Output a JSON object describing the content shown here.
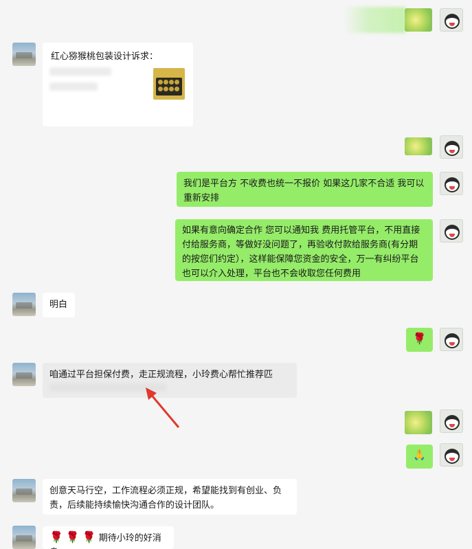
{
  "messages": [
    {
      "id": "m2",
      "text": "红心猕猴桃包装设计诉求："
    },
    {
      "id": "m4",
      "text": "我们是平台方 不收费也统一不报价  如果这几家不合适 我可以重新安排"
    },
    {
      "id": "m5",
      "text": "如果有意向确定合作 您可以通知我 费用托管平台，不用直接付给服务商，等做好没问题了，再验收付款给服务商(有分期的按您们约定），这样能保障您资金的安全，万一有纠纷平台也可以介入处理，平台也不会收取您任何费用"
    },
    {
      "id": "m6",
      "text": "明白"
    },
    {
      "id": "m8",
      "text": "咱通过平台担保付费，走正规流程，小玲费心帮忙推荐匹"
    },
    {
      "id": "m11",
      "text": "创意天马行空，工作流程必须正规，希望能找到有创业、负责，后续能持续愉快沟通合作的设计团队。"
    },
    {
      "id": "m12",
      "text": "期待小玲的好消息"
    }
  ],
  "icons": {
    "rose": "rose-emoji",
    "pray": "folded-hands-emoji",
    "arrow": "red-arrow-annotation"
  },
  "colors": {
    "background": "#f5f5f5",
    "own_bubble": "#95ec69",
    "other_bubble": "#ffffff",
    "arrow": "#e0382b"
  }
}
